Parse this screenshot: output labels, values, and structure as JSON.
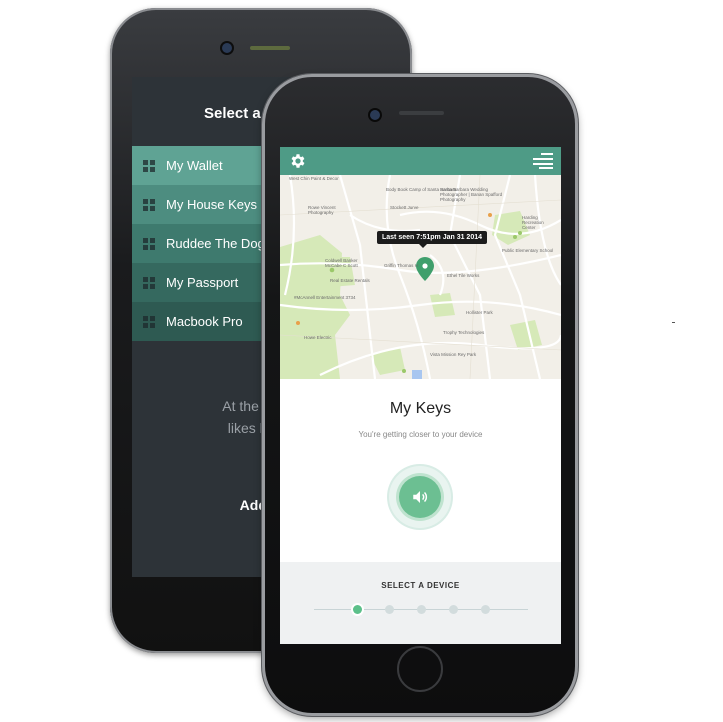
{
  "back_screen": {
    "title": "Select a devi",
    "devices": [
      {
        "label": "My Wallet"
      },
      {
        "label": "My House Keys"
      },
      {
        "label": "Ruddee The Dog"
      },
      {
        "label": "My Passport"
      },
      {
        "label": "Macbook Pro"
      }
    ],
    "message_line1": "At the end of",
    "message_line2": "likes losing",
    "add_label": "Add n"
  },
  "front_screen": {
    "topbar": {
      "settings_icon": "gear-icon",
      "menu_icon": "menu-icon",
      "color": "#4e9b86"
    },
    "map": {
      "tooltip": "Last seen 7:51pm Jan 31 2014",
      "pin_icon": "map-pin-icon",
      "labels": {
        "l1": "West Chin Paint & Decor",
        "l2": "Body Book Camp of Santa Barbara",
        "l3": "Santa Barbara Wedding Photographer | Banan Spafford Photography",
        "l4": "Rowe Vincent Photography",
        "l5": "Stockett Jurve",
        "l6": "Harding Recreation Center",
        "l7": "Public Elementary School",
        "l8": "Coldwell Banker McCabe C Scott",
        "l9": "Griffin Thomas H",
        "l10": "Ethel Tile Works",
        "l11": "Real Estate Rentals",
        "l12": "#McAnnell Entertainment 3734",
        "l13": "Trophy Technologies",
        "l14": "Howe Electric",
        "l15": "Hollister Park",
        "l16": "Vista Mission Rey Park"
      }
    },
    "device_name": "My Keys",
    "device_status": "You're getting closer to your device",
    "sound_icon": "speaker-icon",
    "bottom": {
      "select_label": "SELECT A DEVICE",
      "pager_count": 5,
      "active_index": 0
    }
  },
  "colors": {
    "accent": "#4e9b86",
    "active_dot": "#5cc08a"
  }
}
